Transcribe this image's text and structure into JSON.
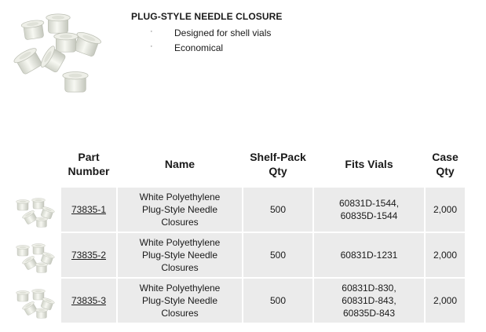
{
  "product": {
    "title": "PLUG-STYLE NEEDLE CLOSURE",
    "bullet_symbol": "·",
    "features": [
      "Designed for shell vials",
      "Economical"
    ]
  },
  "table": {
    "headers": {
      "part_number": "Part\nNumber",
      "name": "Name",
      "shelf_pack_qty": "Shelf-Pack\nQty",
      "fits_vials": "Fits Vials",
      "case_qty": "Case\nQty"
    },
    "rows": [
      {
        "part_number": "73835-1",
        "name": "White Polyethylene\nPlug-Style Needle\nClosures",
        "shelf_pack_qty": "500",
        "fits_vials": "60831D-1544,\n60835D-1544",
        "case_qty": "2,000"
      },
      {
        "part_number": "73835-2",
        "name": "White Polyethylene\nPlug-Style Needle\nClosures",
        "shelf_pack_qty": "500",
        "fits_vials": "60831D-1231",
        "case_qty": "2,000"
      },
      {
        "part_number": "73835-3",
        "name": "White Polyethylene\nPlug-Style Needle\nClosures",
        "shelf_pack_qty": "500",
        "fits_vials": "60831D-830,\n60831D-843,\n60835D-843",
        "case_qty": "2,000"
      }
    ]
  }
}
